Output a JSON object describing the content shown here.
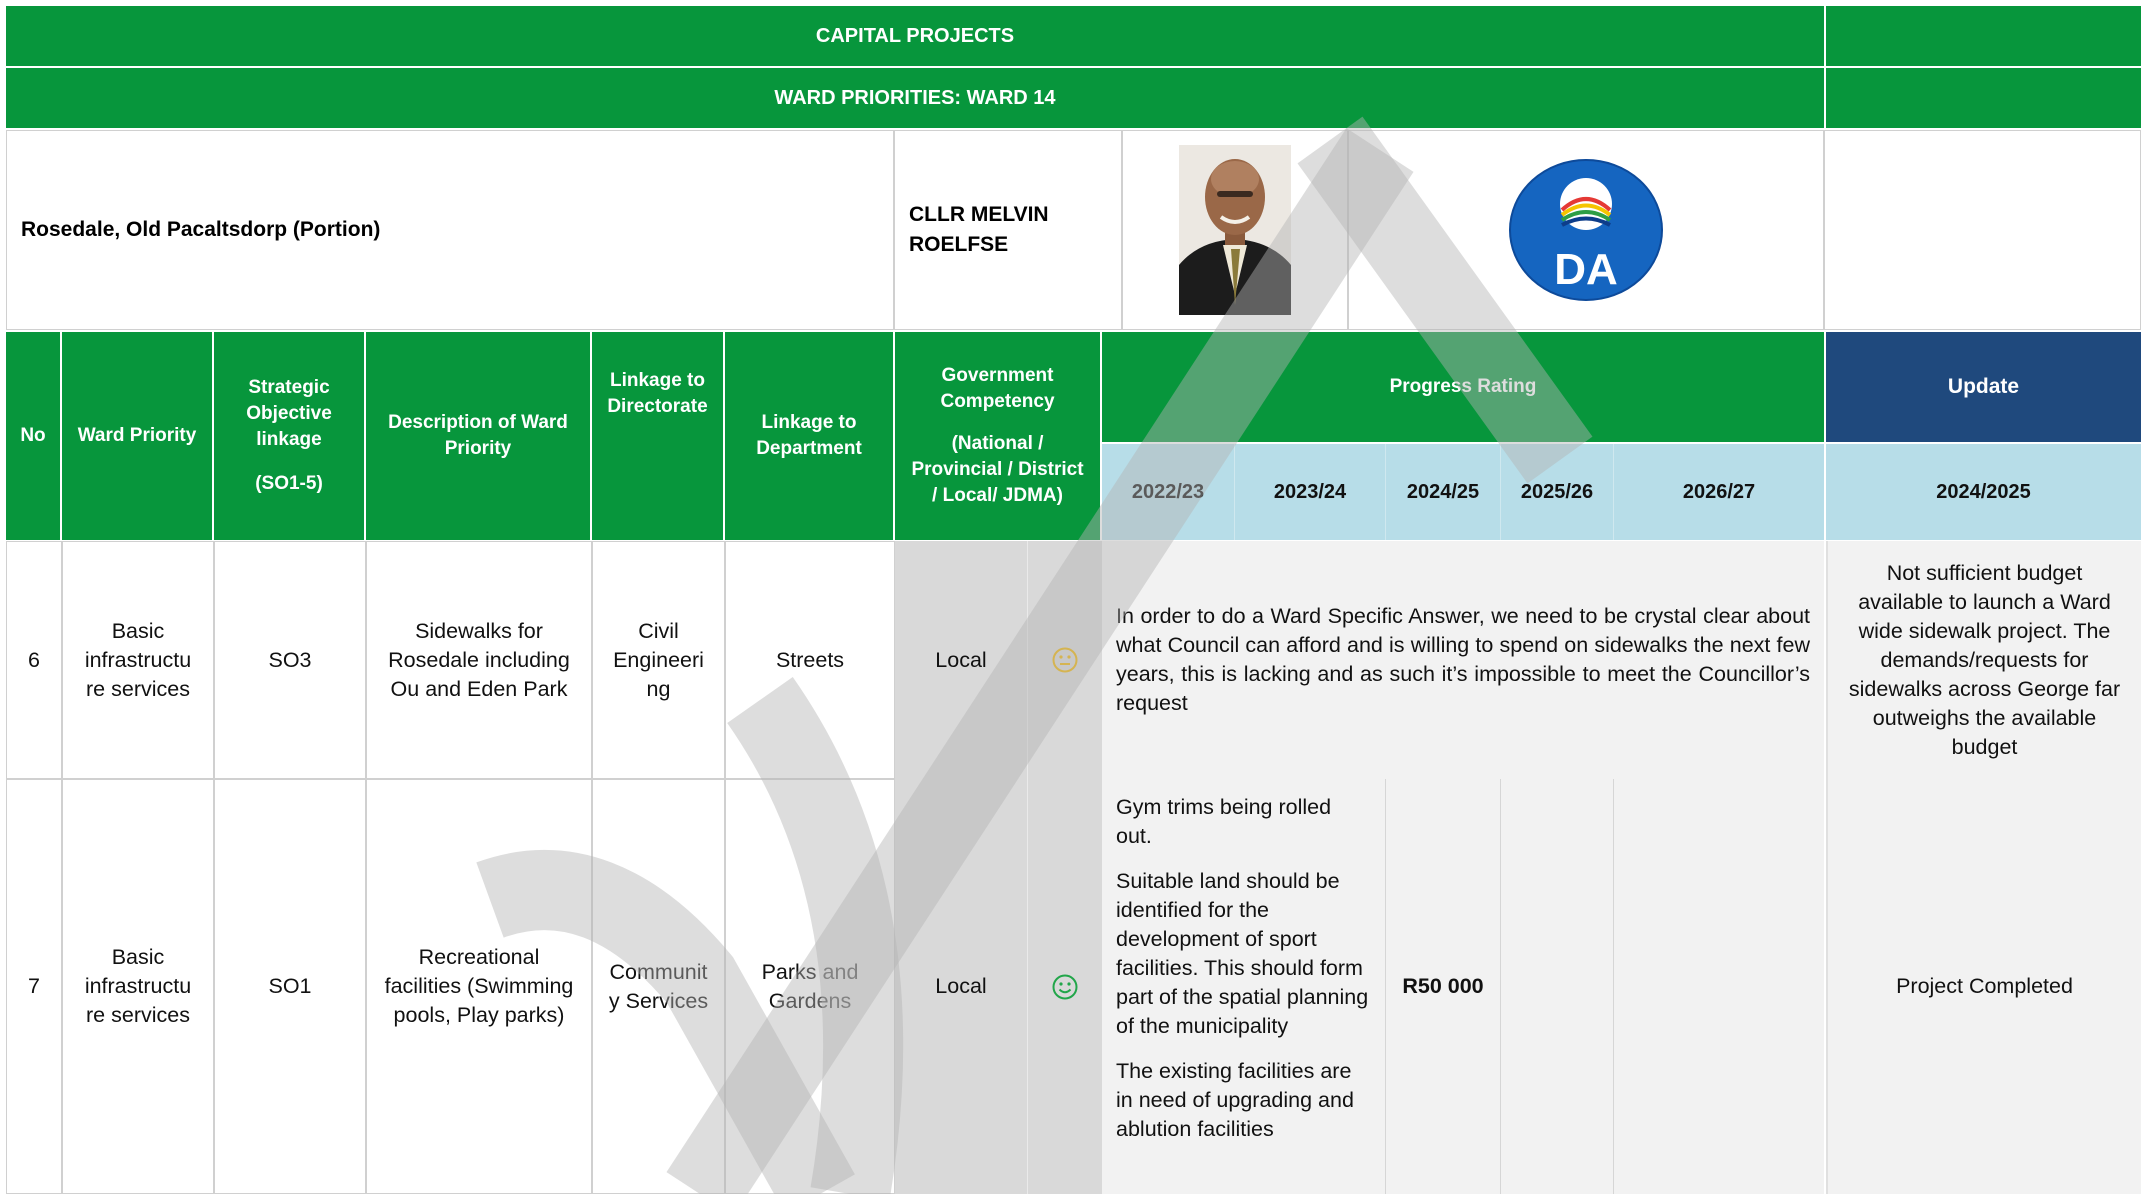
{
  "header": {
    "title": "CAPITAL PROJECTS",
    "subtitle": "WARD PRIORITIES: WARD 14"
  },
  "ward_info": {
    "area": "Rosedale, Old Pacaltsdorp (Portion)",
    "councillor": "CLLR MELVIN ROELFSE",
    "party_logo_text": "DA"
  },
  "columns": {
    "no": "No",
    "ward_priority": "Ward Priority",
    "strategic_objective": "Strategic Objective linkage",
    "strategic_objective_range": "(SO1-5)",
    "description": "Description of Ward Priority",
    "directorate": "Linkage to Directorate",
    "department": "Linkage to Department",
    "competency": "Government Competency",
    "competency_detail": "(National / Provincial / District / Local/ JDMA)",
    "progress": "Progress Rating",
    "update": "Update",
    "years": [
      "2022/23",
      "2023/24",
      "2024/25",
      "2025/26",
      "2026/27"
    ],
    "update_year": "2024/2025"
  },
  "rows": [
    {
      "no": "6",
      "ward_priority": "Basic infrastructu re services",
      "so": "SO3",
      "description": "Sidewalks for Rosedale including Ou and Eden Park",
      "directorate": "Civil Engineeri ng",
      "department": "Streets",
      "competency": "Local",
      "rating_icon": "neutral-face-icon",
      "progress_text": "In order to do a Ward Specific Answer, we need to be crystal clear about what Council can afford and is willing to spend on sidewalks the next few years, this is lacking and as such it’s impossible to meet the Councillor’s request",
      "update": "Not sufficient budget available to launch a Ward wide sidewalk project. The demands/requests for sidewalks across George far outweighs the available budget"
    },
    {
      "no": "7",
      "ward_priority": "Basic infrastructu re services",
      "so": "SO1",
      "description": "Recreational facilities (Swimming pools, Play parks)",
      "directorate": "Communit y Services",
      "department": "Parks and Gardens",
      "competency": "Local",
      "rating_icon": "smiley-face-icon",
      "progress_notes": [
        "Gym trims being rolled out.",
        "Suitable land should be identified for the development of sport facilities. This should form part of the spatial planning of the municipality",
        "The existing facilities are in need of upgrading and ablution facilities"
      ],
      "budget_2024_25": "R50 000",
      "update": "Project Completed"
    }
  ],
  "colors": {
    "green": "#07963c",
    "navy": "#1f497d",
    "light_blue": "#b7dde8",
    "neutral_icon": "#f0b400",
    "smiley_icon": "#22a64a",
    "da_blue": "#1565c0"
  }
}
